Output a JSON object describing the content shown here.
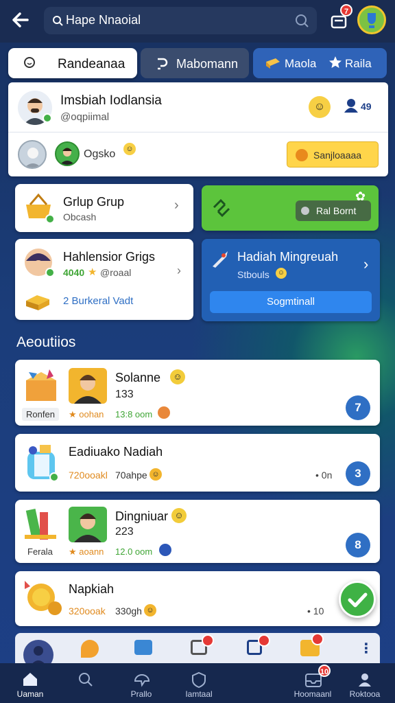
{
  "header": {
    "search_value": "Hape Nnaoial",
    "back_icon": "arrow-left-icon",
    "notif_count": "7"
  },
  "tabs": [
    {
      "label": "Randeanaa",
      "active": true
    },
    {
      "label": "Mabomann"
    },
    {
      "label": "Maola"
    },
    {
      "label": "Raila"
    }
  ],
  "profile": {
    "name": "Imsbiah Iodlansia",
    "handle": "@oqpiimal",
    "count": "49",
    "friend_name": "Ogsko",
    "action_label": "Sanjloaaaa"
  },
  "grid": {
    "group": {
      "title": "Grlup Grup",
      "sub": "Obcash"
    },
    "green": {
      "button": "Ral Bornt"
    },
    "hall": {
      "title": "Hahlensior Grigs",
      "stat_green": "4040",
      "stat_rest": "@roaal",
      "link": "2 Burkeral Vadt"
    },
    "weekly": {
      "title": "Hadiah Mingreuah",
      "sub": "Stbouls",
      "button": "Sogmtinall"
    }
  },
  "section_title": "Aeoutiios",
  "activities": [
    {
      "name": "Solanne",
      "value": "133",
      "stat1": "★ oohan",
      "stat2": "13:8 oom",
      "caption": "Ronfen",
      "count": "7"
    },
    {
      "name": "Eadiuako Nadiah",
      "value": "",
      "stat1": "720ooakl",
      "stat2": "70ahpe",
      "caption": "",
      "side": "• 0n",
      "count": "3"
    },
    {
      "name": "Dingniuar",
      "value": "223",
      "stat1": "★ aoann",
      "stat2": "12.0 oom",
      "caption": "Ferala",
      "count": "8"
    },
    {
      "name": "Napkiah",
      "value": "",
      "stat1": "320ooak",
      "stat2": "330gh",
      "caption": "",
      "side": "• 10"
    }
  ],
  "bottom_nav": [
    {
      "label": "Uaman",
      "icon": "home-icon"
    },
    {
      "label": "",
      "icon": "search-icon"
    },
    {
      "label": "Prallo",
      "icon": "chat-icon"
    },
    {
      "label": "Iamtaal",
      "icon": "shield-icon"
    },
    {
      "label": "Hoomaanl",
      "icon": "inbox-icon",
      "badge": "10"
    },
    {
      "label": "Roktooa",
      "icon": "user-icon"
    }
  ],
  "colors": {
    "primary": "#2f6fc4",
    "green": "#4cbb3c",
    "yellow": "#ffd54a",
    "topbar": "#1a2c52"
  }
}
